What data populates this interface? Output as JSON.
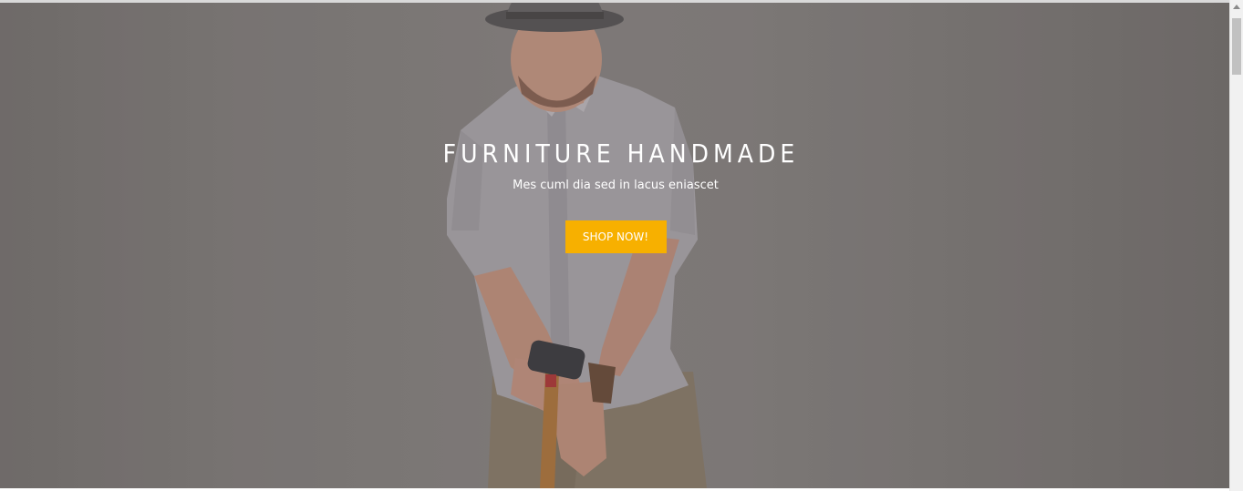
{
  "hero": {
    "title": "FURNITURE HANDMADE",
    "subtitle": "Mes cuml dia sed in lacus eniascet",
    "cta_label": "SHOP NOW!",
    "cta_color": "#f7b000",
    "background_image": "man-with-hammer-photo"
  },
  "scrollbar": {
    "up_icon": "chevron-up-icon"
  }
}
